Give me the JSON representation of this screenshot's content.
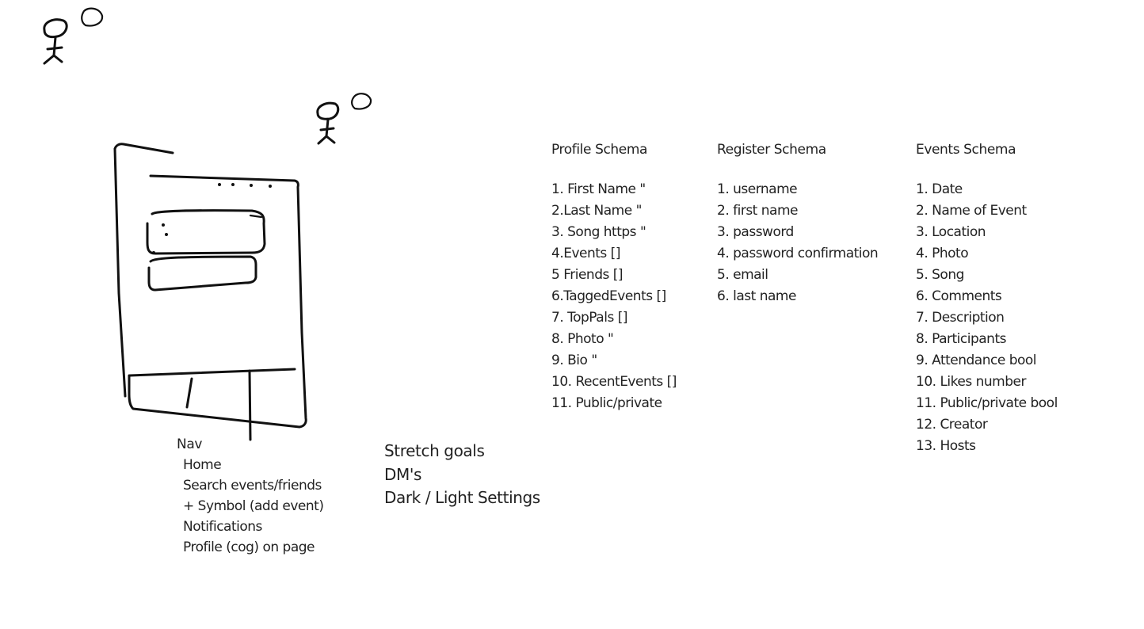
{
  "profile_schema": {
    "title": "Profile Schema",
    "items": [
      "1. First Name \"",
      "2.Last Name \"",
      "3. Song https \"",
      "4.Events []",
      "5 Friends []",
      "6.TaggedEvents []",
      "7. TopPals []",
      "8. Photo \"",
      "9. Bio \"",
      "10. RecentEvents []",
      "11. Public/private"
    ]
  },
  "register_schema": {
    "title": "Register Schema",
    "items": [
      "1. username",
      "2. first name",
      "3. password",
      "4. password confirmation",
      "5. email",
      "6. last name"
    ]
  },
  "events_schema": {
    "title": "Events Schema",
    "items": [
      "1. Date",
      "2. Name of Event",
      "3. Location",
      "4. Photo",
      "5. Song",
      "6. Comments",
      "7. Description",
      "8. Participants",
      "9. Attendance bool",
      "10. Likes number",
      "11. Public/private bool",
      "12. Creator",
      "13. Hosts"
    ]
  },
  "nav": {
    "title": "Nav",
    "items": [
      "Home",
      "Search events/friends",
      "+ Symbol (add event)",
      "Notifications",
      "Profile (cog) on page"
    ]
  },
  "stretch_goals": {
    "items": [
      "Stretch goals",
      "DM's",
      "Dark / Light Settings"
    ]
  },
  "colors": {
    "ink": "#111111",
    "text": "#222222",
    "background": "#ffffff"
  }
}
